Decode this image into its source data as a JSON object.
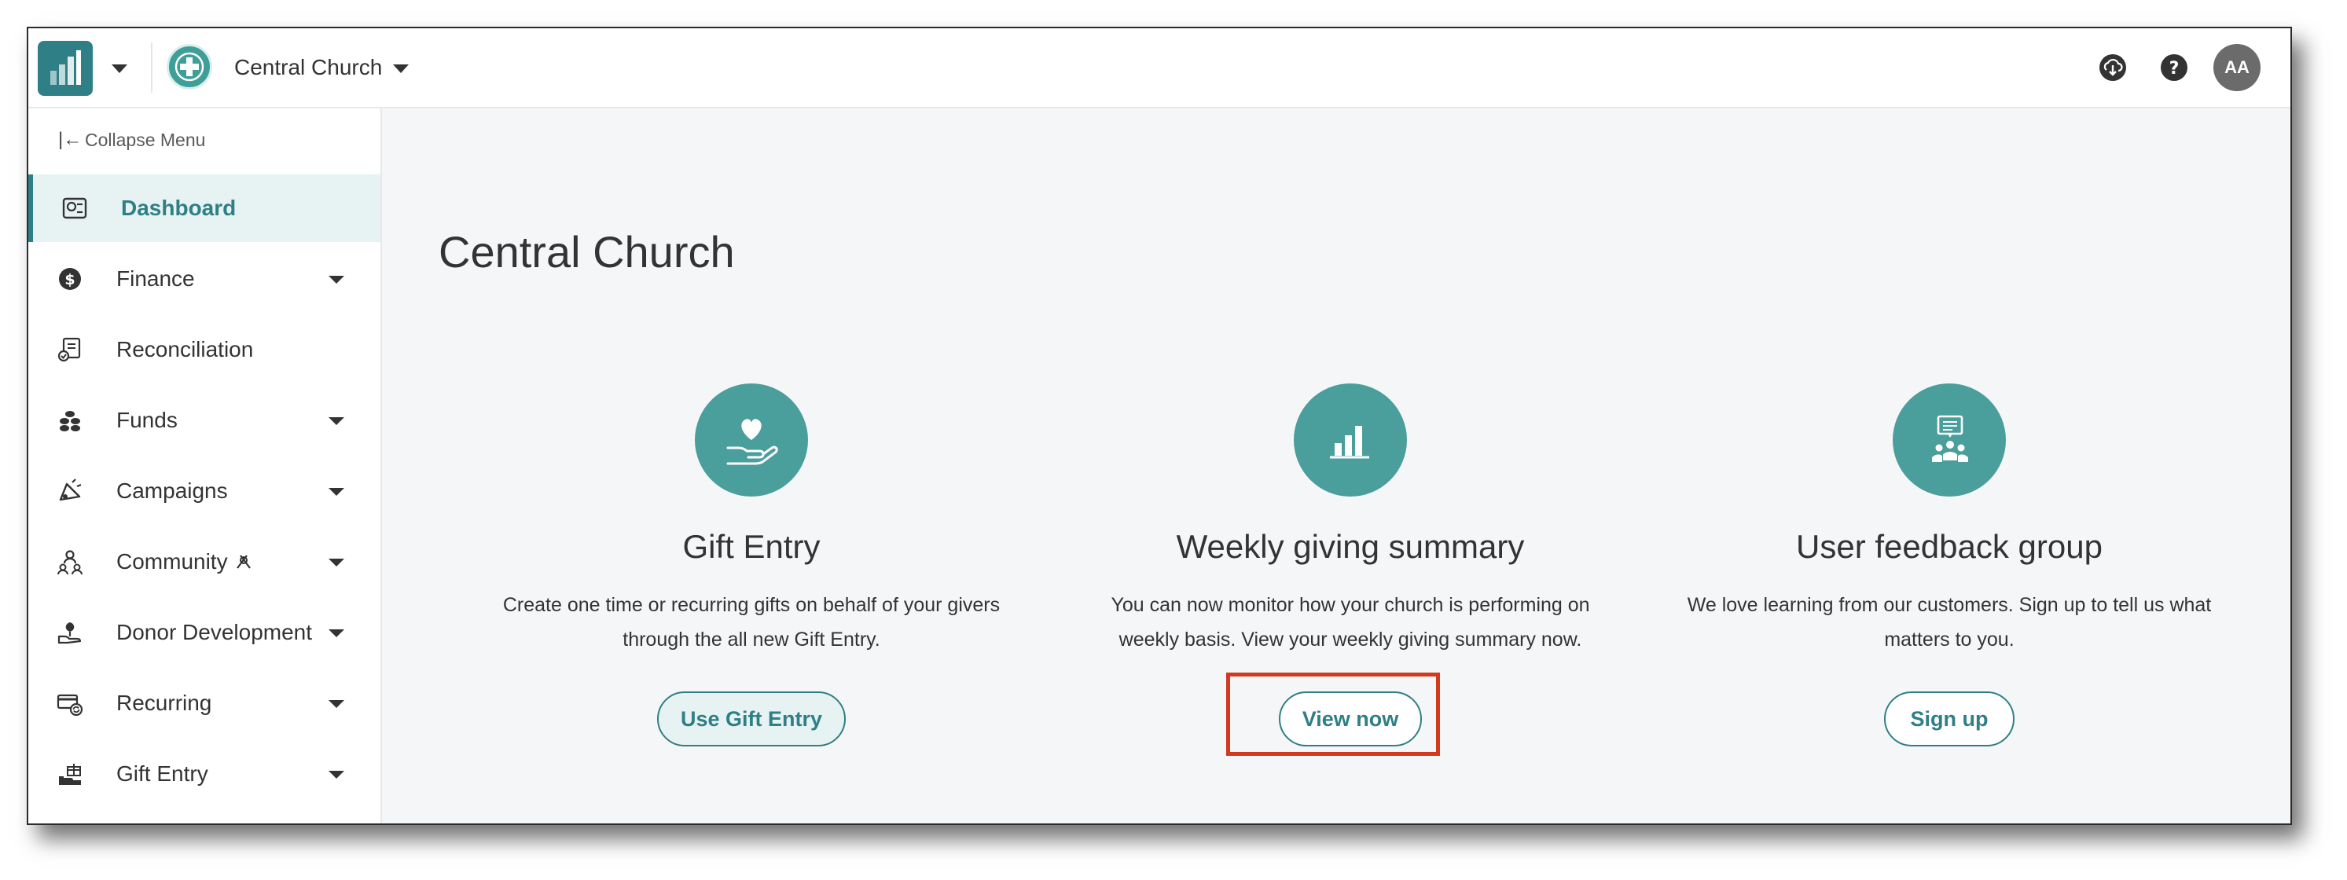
{
  "header": {
    "org_name": "Central Church",
    "avatar_initials": "AA"
  },
  "sidebar": {
    "collapse_label": "Collapse Menu",
    "items": [
      {
        "label": "Dashboard",
        "icon": "dashboard-icon",
        "active": true,
        "has_caret": false
      },
      {
        "label": "Finance",
        "icon": "dollar-icon",
        "active": false,
        "has_caret": true
      },
      {
        "label": "Reconciliation",
        "icon": "reconciliation-icon",
        "active": false,
        "has_caret": false
      },
      {
        "label": "Funds",
        "icon": "funds-icon",
        "active": false,
        "has_caret": true
      },
      {
        "label": "Campaigns",
        "icon": "campaign-icon",
        "active": false,
        "has_caret": true
      },
      {
        "label": "Community",
        "icon": "community-icon",
        "active": false,
        "has_caret": true
      },
      {
        "label": "Donor Development",
        "icon": "donor-icon",
        "active": false,
        "has_caret": true
      },
      {
        "label": "Recurring",
        "icon": "recurring-icon",
        "active": false,
        "has_caret": true
      },
      {
        "label": "Gift Entry",
        "icon": "gift-entry-icon",
        "active": false,
        "has_caret": true
      }
    ]
  },
  "main": {
    "title": "Central Church",
    "cards": [
      {
        "title": "Gift Entry",
        "description": "Create one time or recurring gifts on behalf of your givers through the all new Gift Entry.",
        "button": "Use Gift Entry",
        "icon": "heart-hand-icon"
      },
      {
        "title": "Weekly giving summary",
        "description": "You can now monitor how your church is performing on weekly basis. View your weekly giving summary now.",
        "button": "View now",
        "icon": "bar-chart-icon"
      },
      {
        "title": "User feedback group",
        "description": "We love learning from our customers. Sign up to tell us what matters to you.",
        "button": "Sign up",
        "icon": "feedback-group-icon"
      }
    ]
  },
  "colors": {
    "brand_teal": "#2e7f86",
    "card_icon_bg": "#4a9e9b",
    "active_bg": "#e6f3f2",
    "highlight_red": "#d13a1f"
  }
}
